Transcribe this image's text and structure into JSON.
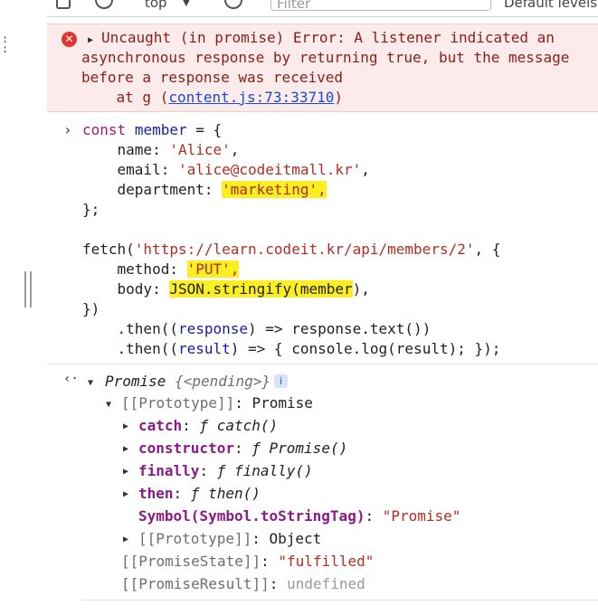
{
  "toolbar": {
    "context": "top",
    "filter_placeholder": "Filter",
    "levels": "Default levels"
  },
  "error": {
    "line1": "Uncaught (in promise) Error: A listener indicated an",
    "line2": "asynchronous response by returning true, but the message",
    "line3": "before a response was received",
    "at_prefix": "    at g (",
    "link": "content.js:73:33710",
    "at_suffix": ")"
  },
  "code": {
    "c1_kw": "const",
    "c1_var": "member",
    "c1_rest": " = {",
    "c2_key": "    name: ",
    "c2_val": "'Alice'",
    "c2_end": ",",
    "c3_key": "    email: ",
    "c3_val": "'alice@codeitmall.kr'",
    "c3_end": ",",
    "c4_key": "    department: ",
    "c4_val": "'marketing',",
    "c5": "};",
    "f1_fn": "fetch(",
    "f1_url": "'https://learn.codeit.kr/api/members/2'",
    "f1_end": ", {",
    "f2_key": "    method: ",
    "f2_val": "'PUT',",
    "f3_key": "    body: ",
    "f3_val": "JSON.stringify(member",
    "f3_end": "),",
    "f4": "})",
    "f5_a": "    .then((",
    "f5_param": "response",
    "f5_b": ") => response.text())",
    "f6_a": "    .then((",
    "f6_param": "result",
    "f6_b": ") => { console.log(result); });"
  },
  "result": {
    "promise": "Promise",
    "pending": "{<pending>}",
    "info": "i",
    "prototype_key": "[[Prototype]]",
    "prototype_val": "Promise",
    "items": [
      {
        "key": "catch",
        "f": "ƒ",
        "fn": "catch()"
      },
      {
        "key": "constructor",
        "f": "ƒ",
        "fn": "Promise()"
      },
      {
        "key": "finally",
        "f": "ƒ",
        "fn": "finally()"
      },
      {
        "key": "then",
        "f": "ƒ",
        "fn": "then()"
      }
    ],
    "symbol_key": "Symbol(Symbol.toStringTag)",
    "symbol_val": "\"Promise\"",
    "proto2_key": "[[Prototype]]",
    "proto2_val": "Object",
    "state_key": "[[PromiseState]]",
    "state_val": "\"fulfilled\"",
    "result_key": "[[PromiseResult]]",
    "result_val": "undefined"
  },
  "colors": {
    "error_bg": "#fcebeb",
    "highlight": "#fbee21",
    "keyword": "#a41868",
    "string": "#b02d24"
  }
}
